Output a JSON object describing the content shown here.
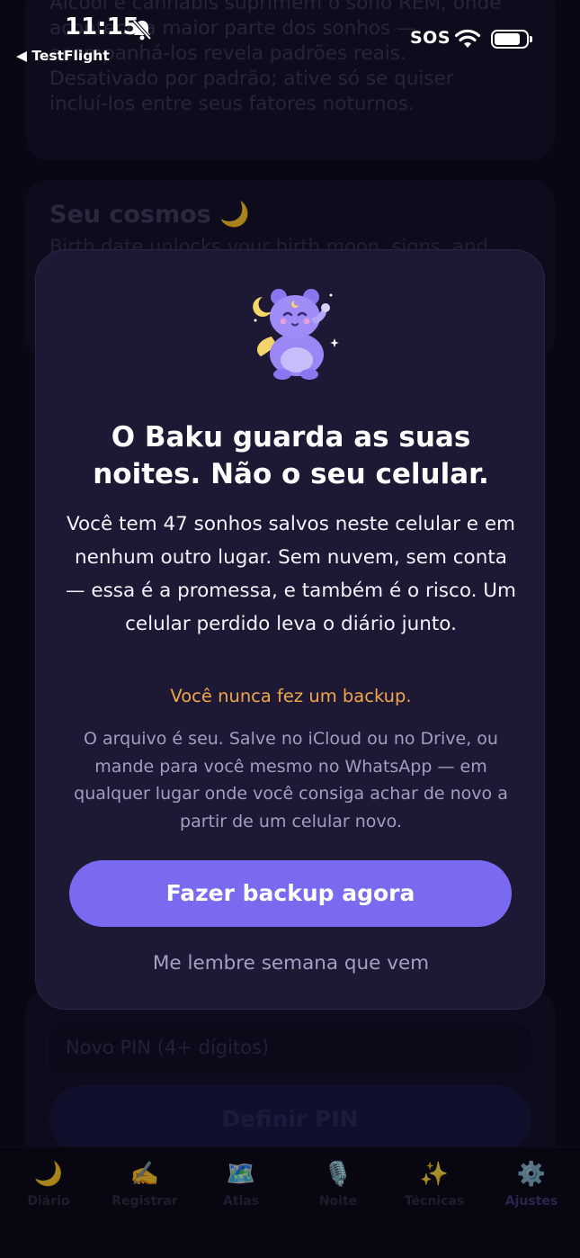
{
  "status_bar": {
    "time": "11:15",
    "back_app": "◀ TestFlight",
    "carrier": "SOS"
  },
  "background": {
    "paragraph": "Álcool e cannabis suprimem o sono REM, onde acontece a maior parte dos sonhos — acompanhá-los revela padrões reais. Desativado por padrão; ative só se quiser incluí-los entre seus fatores noturnos.",
    "cosmos_heading": "Seu cosmos 🌙",
    "cosmos_sub": "Birth date unlocks your birth moon, signs, and",
    "pin_placeholder": "Novo PIN (4+ dígitos)",
    "pin_button": "Definir PIN"
  },
  "tabs": [
    {
      "icon": "🌙",
      "label": "Diário"
    },
    {
      "icon": "✍️",
      "label": "Registrar"
    },
    {
      "icon": "🗺️",
      "label": "Atlas"
    },
    {
      "icon": "🎙️",
      "label": "Noite"
    },
    {
      "icon": "✨",
      "label": "Técnicas"
    },
    {
      "icon": "⚙️",
      "label": "Ajustes"
    }
  ],
  "modal": {
    "title": "O Baku guarda as suas noites. Não o seu celular.",
    "body": "Você tem 47 sonhos salvos neste celular e em nenhum outro lugar. Sem nuvem, sem conta — essa é a promessa, e também é o risco. Um celular perdido leva o diário junto.",
    "warning": "Você nunca fez um backup.",
    "note": "O arquivo é seu. Salve no iCloud ou no Drive, ou mande para você mesmo no WhatsApp — em qualquer lugar onde você consiga achar de novo a partir de um celular novo.",
    "primary_button": "Fazer backup agora",
    "secondary_link": "Me lembre semana que vem"
  },
  "colors": {
    "accent": "#7a6af0",
    "warning": "#f1a64a",
    "modal_bg": "#1d1934"
  }
}
